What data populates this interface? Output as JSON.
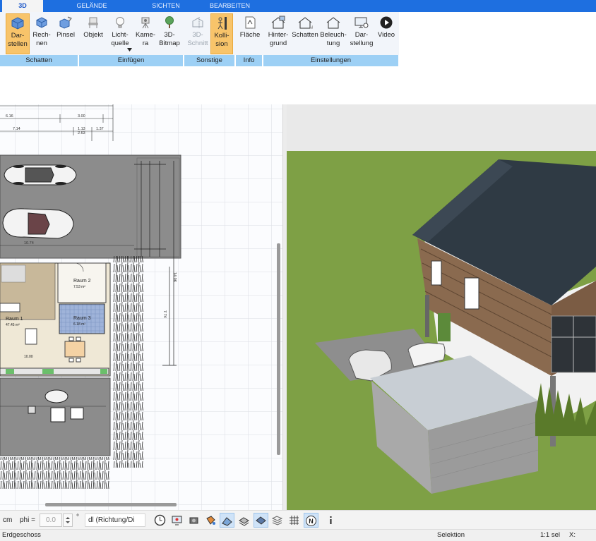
{
  "tabs": [
    {
      "label": "3D",
      "active": true
    },
    {
      "label": "GELÄNDE",
      "active": false
    },
    {
      "label": "SICHTEN",
      "active": false
    },
    {
      "label": "BEARBEITEN",
      "active": false
    }
  ],
  "ribbon": {
    "buttons": {
      "darstellen": "Dar-\nstellen",
      "rechnen": "Rech-\nnen",
      "pinsel": "Pinsel",
      "objekt": "Objekt",
      "lichtquelle": "Licht-\nquelle",
      "kamera": "Kame-\nra",
      "bitmap": "3D-\nBitmap",
      "schnitt": "3D-\nSchnitt",
      "kollision": "Kolli-\nsion",
      "flaeche": "Fläche",
      "hintergrund": "Hinter-\ngrund",
      "schatten": "Schatten",
      "beleuchtung": "Beleuch-\ntung",
      "darstellung": "Dar-\nstellung",
      "video": "Video"
    },
    "groups": {
      "schatten": "Schatten",
      "einfuegen": "Einfügen",
      "sonstige": "Sonstige",
      "info": "Info",
      "einstellungen": "Einstellungen"
    }
  },
  "plan": {
    "dims": {
      "d1": "6.16",
      "d2": "3.00",
      "d3": "7.14",
      "d4": "1.13",
      "d5": "1.37",
      "d6": "2.63",
      "d7": "10.74",
      "d8": "14.06",
      "d9": "7.74",
      "d10": "10.00",
      "d11": "7.74"
    },
    "rooms": {
      "raum1": "Raum 1",
      "raum1_area": "47.45 m²",
      "raum2": "Raum 2",
      "raum2_area": "7.53 m²",
      "raum3": "Raum 3",
      "raum3_area": "6.18 m²"
    }
  },
  "toolbar": {
    "unit": "cm",
    "phi_label": "phi =",
    "phi_value": "0.0",
    "degree": "°",
    "direction_select": "dl (Richtung/Di"
  },
  "status": {
    "floor": "Erdgeschoss",
    "mode": "Selektion",
    "scale": "1:1 sel",
    "coord": "X:"
  }
}
